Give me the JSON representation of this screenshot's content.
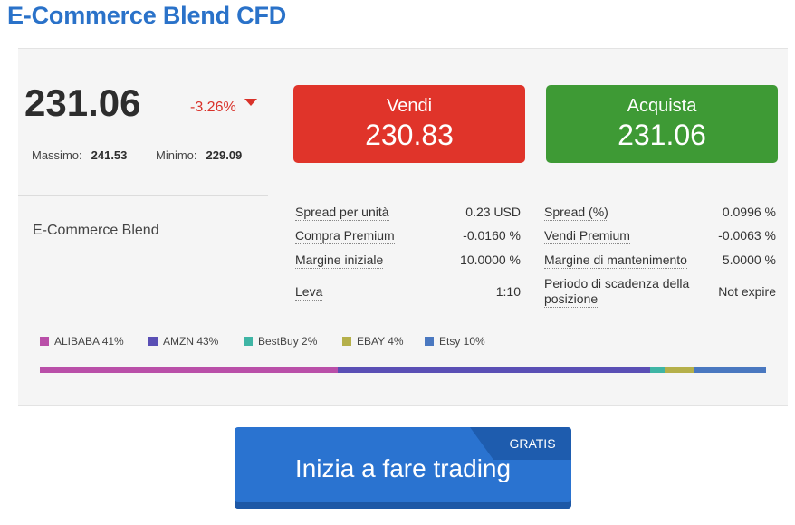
{
  "title": "E-Commerce Blend CFD",
  "quote": {
    "price": "231.06",
    "change": "-3.26%",
    "high_label": "Massimo:",
    "high_value": "241.53",
    "low_label": "Minimo:",
    "low_value": "229.09"
  },
  "instrument_name": "E-Commerce Blend",
  "sell": {
    "label": "Vendi",
    "price": "230.83",
    "color": "#e0342a"
  },
  "buy": {
    "label": "Acquista",
    "price": "231.06",
    "color": "#3e9a35"
  },
  "stats_left": [
    {
      "label": "Spread per unità",
      "value": "0.23 USD"
    },
    {
      "label": "Compra Premium",
      "value": "-0.0160 %"
    },
    {
      "label": "Margine iniziale",
      "value": "10.0000 %"
    },
    {
      "label": "Leva",
      "value": "1:10"
    }
  ],
  "stats_right": [
    {
      "label": "Spread (%)",
      "value": "0.0996 %"
    },
    {
      "label": "Vendi Premium",
      "value": "-0.0063 %"
    },
    {
      "label": "Margine di mantenimento",
      "value": "5.0000 %"
    },
    {
      "label_line1": "Periodo di scadenza della",
      "label_line2": "posizione",
      "value": "Not expire"
    }
  ],
  "composition": [
    {
      "label": "ALIBABA 41%",
      "weight": 41,
      "color": "#b94fa8"
    },
    {
      "label": "AMZN 43%",
      "weight": 43,
      "color": "#5a4fb5"
    },
    {
      "label": "BestBuy 2%",
      "weight": 2,
      "color": "#3fb5a5"
    },
    {
      "label": "EBAY 4%",
      "weight": 4,
      "color": "#b5b04a"
    },
    {
      "label": "Etsy 10%",
      "weight": 10,
      "color": "#4a78c0"
    }
  ],
  "cta": {
    "label": "Inizia a fare trading",
    "badge": "GRATIS"
  }
}
